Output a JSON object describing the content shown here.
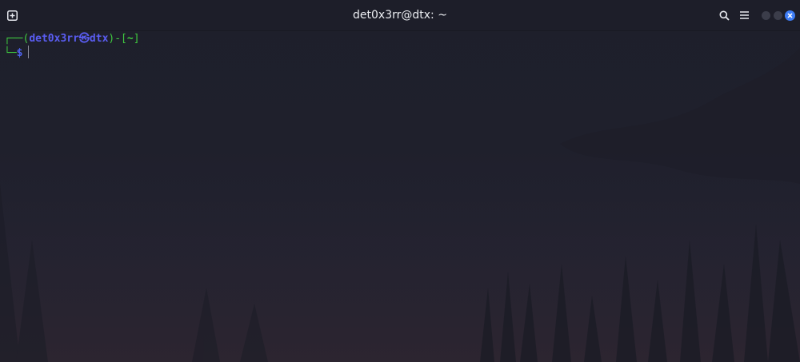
{
  "window": {
    "title": "det0x3rr@dtx: ~"
  },
  "titlebar": {
    "icons": [
      "new-tab-icon",
      "search-icon",
      "menu-icon",
      "minimize-dot",
      "maximize-dot",
      "close-icon"
    ],
    "accent_close_color": "#3e7df5"
  },
  "terminal": {
    "line1": {
      "corner": "┌──(",
      "user_host": "det0x3rr㉿dtx",
      "sep": ")-[",
      "cwd": "~",
      "end": "]"
    },
    "line2": {
      "corner": "└─",
      "prompt": "$"
    },
    "colors": {
      "frame": "#3fca3f",
      "user": "#5a5df2",
      "prompt": "#4e63f0"
    }
  }
}
